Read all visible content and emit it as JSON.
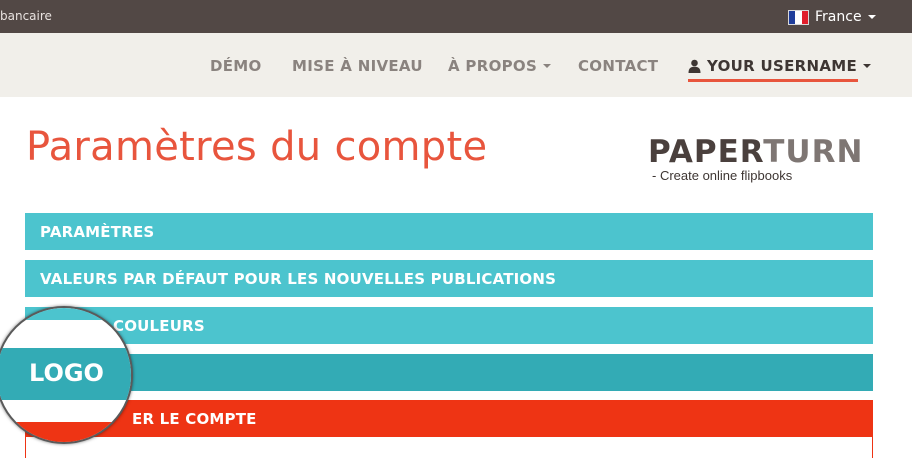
{
  "topbar": {
    "left_text": "bancaire",
    "language": "France",
    "flag_colors": [
      "#1f3d9b",
      "#ffffff",
      "#e01e2b"
    ]
  },
  "nav": {
    "items": [
      "DÉMO",
      "MISE À NIVEAU",
      "À PROPOS",
      "CONTACT"
    ],
    "username": "YOUR USERNAME"
  },
  "page": {
    "title": "Paramètres du compte"
  },
  "brand": {
    "part1": "PAPER",
    "part2": "TURN",
    "tagline": "- Create online flipbooks"
  },
  "sections": [
    "PARAMÈTRES",
    "VALEURS PAR DÉFAUT POUR LES NOUVELLES PUBLICATIONS",
    "COULEURS",
    "",
    "ER LE COMPTE"
  ],
  "magnifier": {
    "label": "LOGO"
  },
  "colors": {
    "accent": "#e8553d",
    "section": "#4cc4ce",
    "section_active": "#33abb5",
    "danger": "#ee3414",
    "topbar": "#524845",
    "navbar": "#f1efea"
  }
}
